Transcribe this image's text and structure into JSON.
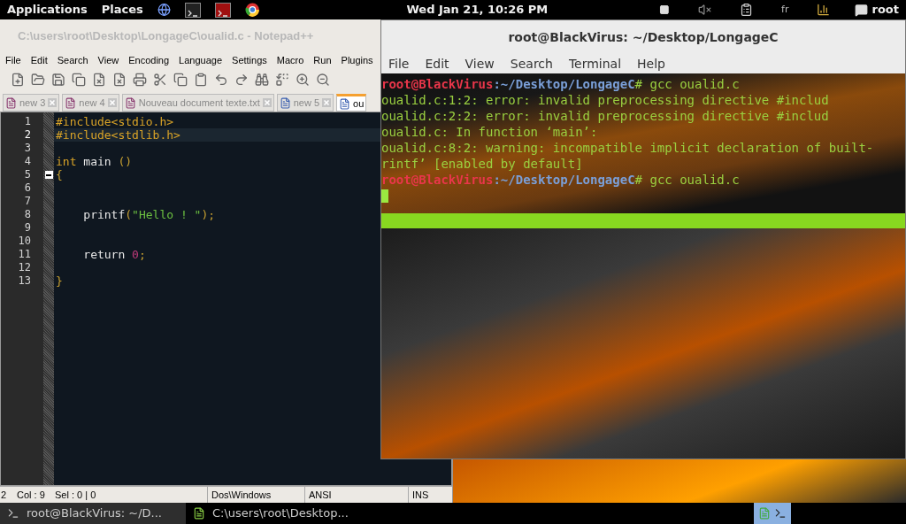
{
  "top_bar": {
    "menus": [
      "Applications",
      "Places"
    ],
    "clock": "Wed Jan 21, 10:26 PM",
    "keyboard_layout": "fr",
    "user": "root"
  },
  "notepad": {
    "title": "C:\\users\\root\\Desktop\\LongageC\\oualid.c - Notepad++",
    "menu": [
      "File",
      "Edit",
      "Search",
      "View",
      "Encoding",
      "Language",
      "Settings",
      "Macro",
      "Run",
      "Plugins"
    ],
    "tabs": [
      {
        "label": "new  3",
        "saved": false,
        "selected": false
      },
      {
        "label": "new  4",
        "saved": false,
        "selected": false
      },
      {
        "label": "Nouveau document texte.txt",
        "saved": false,
        "selected": false
      },
      {
        "label": "new  5",
        "saved": true,
        "selected": false
      },
      {
        "label": "ou",
        "saved": true,
        "selected": true
      }
    ],
    "lines": [
      {
        "number": "1",
        "current": false,
        "tokens": [
          {
            "kind": "preprocessor",
            "text": "#include<stdio.h>"
          }
        ]
      },
      {
        "number": "2",
        "current": true,
        "tokens": [
          {
            "kind": "preprocessor",
            "text": "#include<stdlib.h>"
          }
        ]
      },
      {
        "number": "3",
        "current": false
      },
      {
        "number": "4",
        "current": false,
        "tokens": [
          {
            "kind": "keyword",
            "text": "int"
          },
          {
            "kind": "plain",
            "text": " main "
          },
          {
            "kind": "operator",
            "text": "()"
          }
        ]
      },
      {
        "number": "5",
        "current": false,
        "fold": true,
        "tokens": [
          {
            "kind": "operator",
            "text": "{"
          }
        ]
      },
      {
        "number": "6",
        "current": false
      },
      {
        "number": "7",
        "current": false
      },
      {
        "number": "8",
        "current": false,
        "tokens": [
          {
            "kind": "plain",
            "text": "    printf"
          },
          {
            "kind": "operator",
            "text": "("
          },
          {
            "kind": "string",
            "text": "\"Hello ! \""
          },
          {
            "kind": "operator",
            "text": ");"
          }
        ]
      },
      {
        "number": "9",
        "current": false
      },
      {
        "number": "10",
        "current": false
      },
      {
        "number": "11",
        "current": false,
        "tokens": [
          {
            "kind": "plain",
            "text": "    return "
          },
          {
            "kind": "number",
            "text": "0"
          },
          {
            "kind": "operator",
            "text": ";"
          }
        ]
      },
      {
        "number": "12",
        "current": false
      },
      {
        "number": "13",
        "current": false,
        "tokens": [
          {
            "kind": "operator",
            "text": "}"
          }
        ]
      }
    ],
    "status_bar": {
      "line": "2",
      "column": "Col : 9",
      "selection": "Sel : 0 | 0",
      "eol": "Dos\\Windows",
      "encoding": "ANSI",
      "mode": "INS"
    }
  },
  "terminal": {
    "title": "root@BlackVirus: ~/Desktop/LongageC",
    "menu": [
      "File",
      "Edit",
      "View",
      "Search",
      "Terminal",
      "Help"
    ],
    "lines": [
      {
        "kind": "prompt",
        "user": "root@BlackVirus",
        "path": ":~/Desktop/LongageC",
        "command": "# gcc oualid.c"
      },
      {
        "kind": "output",
        "text": "oualid.c:1:2: error: invalid preprocessing directive #includ"
      },
      {
        "kind": "output",
        "text": "oualid.c:2:2: error: invalid preprocessing directive #includ"
      },
      {
        "kind": "output",
        "text": "oualid.c: In function ‘main’:"
      },
      {
        "kind": "output",
        "text": "oualid.c:8:2: warning: incompatible implicit declaration of built-"
      },
      {
        "kind": "output",
        "text": "rintf’ [enabled by default]"
      },
      {
        "kind": "prompt",
        "user": "root@BlackVirus",
        "path": ":~/Desktop/LongageC",
        "command": "# gcc oualid.c"
      }
    ]
  },
  "taskbar": {
    "items": [
      {
        "kind": "terminal",
        "label": "root@BlackVirus: ~/D..."
      },
      {
        "kind": "editor",
        "label": "C:\\users\\root\\Desktop..."
      }
    ]
  }
}
